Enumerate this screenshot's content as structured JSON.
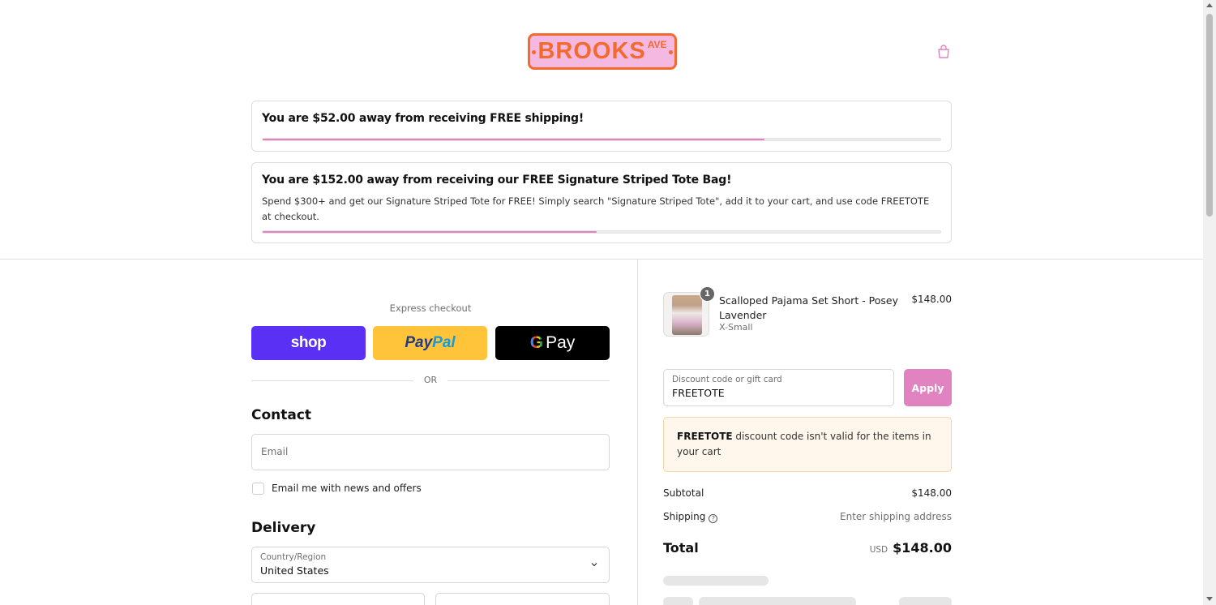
{
  "header": {
    "logo_text": "BROOKS",
    "logo_sup": "AVE",
    "cart_icon": "shopping-bag-icon"
  },
  "banners": {
    "shipping": {
      "message": "You are $52.00 away from receiving FREE shipping!",
      "progress": 0.74
    },
    "tote": {
      "message": "You are $152.00 away from receiving our FREE Signature Striped Tote Bag!",
      "description": "Spend $300+ and get our Signature Striped Tote for FREE! Simply search \"Signature Striped Tote\", add it to your cart, and use code FREETOTE at checkout.",
      "progress": 0.493
    }
  },
  "express": {
    "label": "Express checkout",
    "shop_label": "shop",
    "paypal_label_1": "Pay",
    "paypal_label_2": "Pal",
    "gpay_g": "G",
    "gpay_label": "Pay",
    "or_label": "OR"
  },
  "contact": {
    "title": "Contact",
    "email_placeholder": "Email",
    "newsletter_label": "Email me with news and offers"
  },
  "delivery": {
    "title": "Delivery",
    "country_label": "Country/Region",
    "country_value": "United States"
  },
  "order": {
    "item": {
      "quantity": "1",
      "name": "Scalloped Pajama Set Short - Posey Lavender",
      "variant": "X-Small",
      "price": "$148.00"
    },
    "discount": {
      "label": "Discount code or gift card",
      "value": "FREETOTE",
      "apply_label": "Apply",
      "error_code": "FREETOTE",
      "error_text": " discount code isn't valid for the items in your cart"
    },
    "subtotal_label": "Subtotal",
    "subtotal_value": "$148.00",
    "shipping_label": "Shipping",
    "shipping_value": "Enter shipping address",
    "total_label": "Total",
    "currency": "USD",
    "total_value": "$148.00"
  },
  "colors": {
    "accent_pink": "#e083c0",
    "brand_orange": "#f26a2e",
    "shop_purple": "#5a31f4",
    "paypal_yellow": "#ffc439"
  }
}
